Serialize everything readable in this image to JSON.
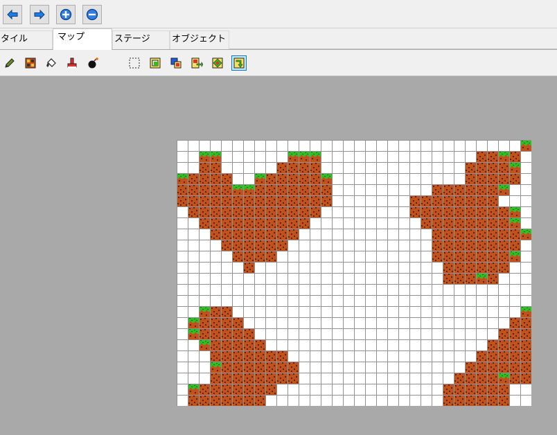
{
  "toolbar": {
    "buttons": [
      {
        "name": "back-button",
        "icon": "arrow-left-icon"
      },
      {
        "name": "forward-button",
        "icon": "arrow-right-icon"
      },
      {
        "name": "zoom-in-button",
        "icon": "zoom-in-icon"
      },
      {
        "name": "zoom-out-button",
        "icon": "zoom-out-icon"
      }
    ]
  },
  "tabs": [
    {
      "label": "タイル",
      "active": false
    },
    {
      "label": "マップ",
      "active": true
    },
    {
      "label": "ステージ",
      "active": false
    },
    {
      "label": "オブジェクト",
      "active": false
    }
  ],
  "tools": [
    {
      "name": "pencil-tool",
      "icon": "pencil-icon",
      "selected": false
    },
    {
      "name": "tile-stamp-tool",
      "icon": "tile-stamp-icon",
      "selected": false
    },
    {
      "name": "fill-tool",
      "icon": "paint-bucket-icon",
      "selected": false
    },
    {
      "name": "eraser-tool",
      "icon": "eraser-icon",
      "selected": false
    },
    {
      "name": "bomb-tool",
      "icon": "bomb-icon",
      "selected": false
    },
    {
      "name": "select-tool",
      "icon": "dashed-select-icon",
      "selected": false
    },
    {
      "name": "copy-tool",
      "icon": "copy-icon",
      "selected": false
    },
    {
      "name": "paste-tool",
      "icon": "paste-icon",
      "selected": false
    },
    {
      "name": "move-tool",
      "icon": "move-icon",
      "selected": false
    },
    {
      "name": "flip-tool",
      "icon": "flip-icon",
      "selected": false
    },
    {
      "name": "rotate-tool",
      "icon": "rotate-icon",
      "selected": true
    }
  ],
  "colors": {
    "workspace": "#a9a9a9",
    "grid_line": "#909090",
    "cell_empty": "#ffffff",
    "dirt": "#c0521a",
    "dirt_dark": "#5a2208",
    "grass": "#2fbf24",
    "grass_dark": "#0f6b0c"
  },
  "map": {
    "rows": [
      "...............................G..................",
      "..GG......GGG..............DDGD....................",
      "..DD.....DDDD.............DDDDG....................",
      "GDDDD..GDDDDDG............DDDDD....................",
      "DDDDDGGDDDDDDD.........DDDDDDG.....................",
      "DDDDDDDDDDDDDD.......DDDDDDDD......................",
      ".DDDDDDDDDDDD........DDDDDDDDDG....................",
      "..DDDDDDDDDD..........DDDDDDDDG....................",
      "...DDDDDDDD............DDDDDDDDG...................",
      "....DDDDDD.............DDDDDDDD....................",
      ".....DDDD..............DDDDDDDG....................",
      "......D.................DDDDDD.....................",
      "........................DDDGD......................",
      "...................................................",
      "...................................................",
      "..GDD..........................G...................",
      ".GDDDD........................DD...................",
      ".GDDDDD......................DDDD..................",
      "..GDDDDD....................DDDDDD.................",
      "...DDDDDDD.................DDDDDDDD................",
      "...GDDDDDDD...............DDDDDDDDDD...............",
      "...DDDDDDDD..............DDDDGDDDDDDD..............",
      ".GDDDDDDD...............DDDDDD..DDDDDD.............",
      ".DDDDDDD................DDDDDD...DDDDDD............",
      ".GDDDD...................GGG.......GGG.............",
      "..GDD..........................................",
      "...................................................",
      "...................................................",
      "...................................................",
      "...................................................",
      "...................................................",
      "...................................................",
      "...................................................",
      "..................................................."
    ]
  }
}
